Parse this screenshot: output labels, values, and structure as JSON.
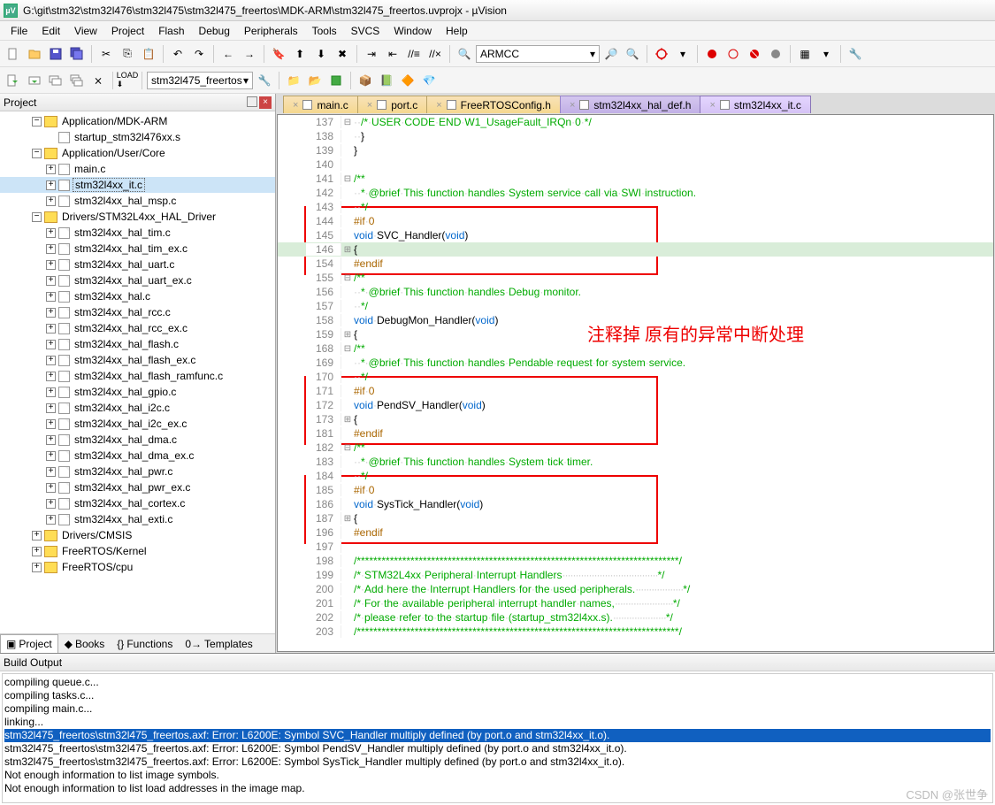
{
  "window": {
    "title": "G:\\git\\stm32\\stm32l476\\stm32l475\\stm32l475_freertos\\MDK-ARM\\stm32l475_freertos.uvprojx - µVision"
  },
  "menu": [
    "File",
    "Edit",
    "View",
    "Project",
    "Flash",
    "Debug",
    "Peripherals",
    "Tools",
    "SVCS",
    "Window",
    "Help"
  ],
  "toolbar": {
    "target_select": "stm32l475_freertos",
    "compiler": "ARMCC"
  },
  "project_panel": {
    "title": "Project",
    "tabs": [
      "Project",
      "Books",
      "Functions",
      "Templates"
    ]
  },
  "tree": {
    "app_mdk": "Application/MDK-ARM",
    "startup": "startup_stm32l476xx.s",
    "app_user": "Application/User/Core",
    "files_user": [
      "main.c",
      "stm32l4xx_it.c",
      "stm32l4xx_hal_msp.c"
    ],
    "hal_drv": "Drivers/STM32L4xx_HAL_Driver",
    "files_hal": [
      "stm32l4xx_hal_tim.c",
      "stm32l4xx_hal_tim_ex.c",
      "stm32l4xx_hal_uart.c",
      "stm32l4xx_hal_uart_ex.c",
      "stm32l4xx_hal.c",
      "stm32l4xx_hal_rcc.c",
      "stm32l4xx_hal_rcc_ex.c",
      "stm32l4xx_hal_flash.c",
      "stm32l4xx_hal_flash_ex.c",
      "stm32l4xx_hal_flash_ramfunc.c",
      "stm32l4xx_hal_gpio.c",
      "stm32l4xx_hal_i2c.c",
      "stm32l4xx_hal_i2c_ex.c",
      "stm32l4xx_hal_dma.c",
      "stm32l4xx_hal_dma_ex.c",
      "stm32l4xx_hal_pwr.c",
      "stm32l4xx_hal_pwr_ex.c",
      "stm32l4xx_hal_cortex.c",
      "stm32l4xx_hal_exti.c"
    ],
    "cmsis": "Drivers/CMSIS",
    "freertos_k": "FreeRTOS/Kernel",
    "freertos_c": "FreeRTOS/cpu"
  },
  "editor_tabs": [
    {
      "label": "main.c",
      "cls": ""
    },
    {
      "label": "port.c",
      "cls": ""
    },
    {
      "label": "FreeRTOSConfig.h",
      "cls": ""
    },
    {
      "label": "stm32l4xx_hal_def.h",
      "cls": "purple"
    },
    {
      "label": "stm32l4xx_it.c",
      "cls": "active"
    }
  ],
  "code": [
    {
      "n": 137,
      "fold": "-",
      "html": "··<span class='cm'>/*·USER·CODE·END·W1_UsageFault_IRQn·0·*/</span>"
    },
    {
      "n": 138,
      "fold": "",
      "html": "··}"
    },
    {
      "n": 139,
      "fold": "",
      "html": "}"
    },
    {
      "n": 140,
      "fold": "",
      "html": ""
    },
    {
      "n": 141,
      "fold": "-",
      "html": "<span class='cm'>/**</span>"
    },
    {
      "n": 142,
      "fold": "",
      "html": "<span class='cm'>··*·@brief·This·function·handles·System·service·call·via·SWI·instruction.</span>"
    },
    {
      "n": 143,
      "fold": "",
      "html": "<span class='cm'>··*/</span>"
    },
    {
      "n": 144,
      "fold": "",
      "html": "<span class='pp'>#if·0</span>"
    },
    {
      "n": 145,
      "fold": "",
      "html": "<span class='tp'>void</span>·SVC_Handler(<span class='tp'>void</span>)"
    },
    {
      "n": 146,
      "fold": "+",
      "html": "{",
      "hl": true
    },
    {
      "n": 154,
      "fold": "",
      "html": "<span class='pp'>#endif</span>"
    },
    {
      "n": 155,
      "fold": "-",
      "html": "<span class='cm'>/**</span>"
    },
    {
      "n": 156,
      "fold": "",
      "html": "<span class='cm'>··*·@brief·This·function·handles·Debug·monitor.</span>"
    },
    {
      "n": 157,
      "fold": "",
      "html": "<span class='cm'>··*/</span>"
    },
    {
      "n": 158,
      "fold": "",
      "html": "<span class='tp'>void</span>·DebugMon_Handler(<span class='tp'>void</span>)"
    },
    {
      "n": 159,
      "fold": "+",
      "html": "{"
    },
    {
      "n": 168,
      "fold": "-",
      "html": "<span class='cm'>/**</span>"
    },
    {
      "n": 169,
      "fold": "",
      "html": "<span class='cm'>··*·@brief·This·function·handles·Pendable·request·for·system·service.</span>"
    },
    {
      "n": 170,
      "fold": "",
      "html": "<span class='cm'>··*/</span>"
    },
    {
      "n": 171,
      "fold": "",
      "html": "<span class='pp'>#if·0</span>"
    },
    {
      "n": 172,
      "fold": "",
      "html": "<span class='tp'>void</span>·PendSV_Handler(<span class='tp'>void</span>)"
    },
    {
      "n": 173,
      "fold": "+",
      "html": "{"
    },
    {
      "n": 181,
      "fold": "",
      "html": "<span class='pp'>#endif</span>"
    },
    {
      "n": 182,
      "fold": "-",
      "html": "<span class='cm'>/**</span>"
    },
    {
      "n": 183,
      "fold": "",
      "html": "<span class='cm'>··*·@brief·This·function·handles·System·tick·timer.</span>"
    },
    {
      "n": 184,
      "fold": "",
      "html": "<span class='cm'>··*/</span>"
    },
    {
      "n": 185,
      "fold": "",
      "html": "<span class='pp'>#if·0</span>"
    },
    {
      "n": 186,
      "fold": "",
      "html": "<span class='tp'>void</span>·SysTick_Handler(<span class='tp'>void</span>)"
    },
    {
      "n": 187,
      "fold": "+",
      "html": "{"
    },
    {
      "n": 196,
      "fold": "",
      "html": "<span class='pp'>#endif</span>"
    },
    {
      "n": 197,
      "fold": "",
      "html": ""
    },
    {
      "n": 198,
      "fold": "",
      "html": "<span class='cm'>/******************************************************************************/</span>"
    },
    {
      "n": 199,
      "fold": "",
      "html": "<span class='cm'>/*·STM32L4xx·Peripheral·Interrupt·Handlers<span class='dots'>····································</span>*/</span>"
    },
    {
      "n": 200,
      "fold": "",
      "html": "<span class='cm'>/*·Add·here·the·Interrupt·Handlers·for·the·used·peripherals.<span class='dots'>··················</span>*/</span>"
    },
    {
      "n": 201,
      "fold": "",
      "html": "<span class='cm'>/*·For·the·available·peripheral·interrupt·handler·names,<span class='dots'>······················</span>*/</span>"
    },
    {
      "n": 202,
      "fold": "",
      "html": "<span class='cm'>/*·please·refer·to·the·startup·file·(startup_stm32l4xx.s).<span class='dots'>····················</span>*/</span>"
    },
    {
      "n": 203,
      "fold": "",
      "html": "<span class='cm'>/******************************************************************************/</span>"
    }
  ],
  "annotation": "注释掉 原有的异常中断处理",
  "build": {
    "title": "Build Output",
    "lines": [
      {
        "t": "compiling queue.c..."
      },
      {
        "t": "compiling tasks.c..."
      },
      {
        "t": "compiling main.c..."
      },
      {
        "t": "linking..."
      },
      {
        "t": "stm32l475_freertos\\stm32l475_freertos.axf: Error: L6200E: Symbol SVC_Handler multiply defined (by port.o and stm32l4xx_it.o).",
        "sel": true
      },
      {
        "t": "stm32l475_freertos\\stm32l475_freertos.axf: Error: L6200E: Symbol PendSV_Handler multiply defined (by port.o and stm32l4xx_it.o)."
      },
      {
        "t": "stm32l475_freertos\\stm32l475_freertos.axf: Error: L6200E: Symbol SysTick_Handler multiply defined (by port.o and stm32l4xx_it.o)."
      },
      {
        "t": "Not enough information to list image symbols."
      },
      {
        "t": "Not enough information to list load addresses in the image map."
      }
    ]
  },
  "watermark": "CSDN @张世争"
}
